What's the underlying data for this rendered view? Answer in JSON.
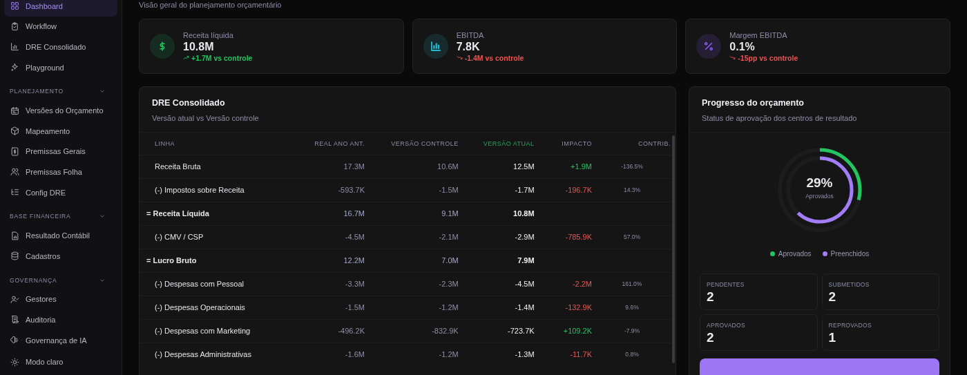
{
  "sidebar": {
    "items": [
      {
        "label": "Dashboard",
        "selected": true
      },
      {
        "label": "Workflow",
        "selected": false
      },
      {
        "label": "DRE Consolidado",
        "selected": false
      },
      {
        "label": "Playground",
        "selected": false
      }
    ],
    "sections": [
      {
        "title": "PLANEJAMENTO",
        "expanded": true,
        "items": [
          {
            "label": "Versões do Orçamento",
            "selected": false
          },
          {
            "label": "Mapeamento",
            "selected": false
          },
          {
            "label": "Premissas Gerais",
            "selected": false
          },
          {
            "label": "Premissas Folha",
            "selected": false
          },
          {
            "label": "Config DRE",
            "selected": false
          }
        ]
      },
      {
        "title": "BASE FINANCEIRA",
        "expanded": true,
        "items": [
          {
            "label": "Resultado Contábil",
            "selected": false
          },
          {
            "label": "Cadastros",
            "selected": false
          }
        ]
      },
      {
        "title": "GOVERNANÇA",
        "expanded": true,
        "items": [
          {
            "label": "Gestores",
            "selected": false
          },
          {
            "label": "Auditoria",
            "selected": false
          },
          {
            "label": "Governança de IA",
            "selected": false
          }
        ]
      }
    ],
    "theme_toggle": "Modo claro"
  },
  "page": {
    "subtitle": "Visão geral do planejamento orçamentário"
  },
  "kpis": [
    {
      "label": "Receita líquida",
      "value": "10.8M",
      "delta": {
        "text": "+1.7M vs controle",
        "color": "#22c55e"
      },
      "color": "#22c55e"
    },
    {
      "label": "EBITDA",
      "value": "7.8K",
      "delta": {
        "text": "-1.4M vs controle",
        "color": "#ef5350"
      },
      "color": "#22b8cf"
    },
    {
      "label": "Margem EBITDA",
      "value": "0.1%",
      "delta": {
        "text": "-15pp vs controle",
        "color": "#ef5350"
      },
      "color": "#8b5cf6"
    }
  ],
  "dre": {
    "title": "DRE Consolidado",
    "subtitle": "Versão atual vs Versão controle",
    "columns": [
      "LINHA",
      "REAL ANO ANT.",
      "VERSÃO CONTROLE",
      "VERSÃO ATUAL",
      "IMPACTO",
      "CONTRIB."
    ],
    "rows": [
      {
        "kind": "item",
        "cells": [
          "Receita Bruta",
          "17.3M",
          "10.6M",
          "12.5M",
          "+1.9M",
          "-136.5%"
        ],
        "color": "#22c55e"
      },
      {
        "kind": "item",
        "cells": [
          "(-) Impostos sobre Receita",
          "-593.7K",
          "-1.5M",
          "-1.7M",
          "-196.7K",
          "14.3%"
        ],
        "color": "#ef5350"
      },
      {
        "kind": "total",
        "cells": [
          "= Receita Líquida",
          "16.7M",
          "9.1M",
          "10.8M"
        ]
      },
      {
        "kind": "item",
        "cells": [
          "(-) CMV / CSP",
          "-4.5M",
          "-2.1M",
          "-2.9M",
          "-785.9K",
          "57.0%"
        ],
        "color": "#ef5350"
      },
      {
        "kind": "total",
        "cells": [
          "= Lucro Bruto",
          "12.2M",
          "7.0M",
          "7.9M"
        ]
      },
      {
        "kind": "item",
        "cells": [
          "(-) Despesas com Pessoal",
          "-3.3M",
          "-2.3M",
          "-4.5M",
          "-2.2M",
          "161.0%"
        ],
        "color": "#ef5350"
      },
      {
        "kind": "item",
        "cells": [
          "(-) Despesas Operacionais",
          "-1.5M",
          "-1.2M",
          "-1.4M",
          "-132.9K",
          "9.6%"
        ],
        "color": "#ef5350"
      },
      {
        "kind": "item",
        "cells": [
          "(-) Despesas com Marketing",
          "-496.2K",
          "-832.9K",
          "-723.7K",
          "+109.2K",
          "-7.9%"
        ],
        "color": "#22c55e"
      },
      {
        "kind": "item",
        "cells": [
          "(-) Despesas Administrativas",
          "-1.6M",
          "-1.2M",
          "-1.3M",
          "-11.7K",
          "0.8%"
        ],
        "color": "#ef5350"
      }
    ]
  },
  "progress": {
    "title": "Progresso do orçamento",
    "subtitle": "Status de aprovação dos centros de resultado",
    "percent": "29%",
    "percent_label": "Aprovados",
    "rings": [
      {
        "label": "Aprovados",
        "color": "#22c55e",
        "level": 0.29
      },
      {
        "label": "Preenchidos",
        "color": "#a37cf7",
        "level": 0.62
      }
    ],
    "stats": [
      {
        "label": "PENDENTES",
        "value": "2"
      },
      {
        "label": "SUBMETIDOS",
        "value": "2"
      },
      {
        "label": "APROVADOS",
        "value": "2"
      },
      {
        "label": "REPROVADOS",
        "value": "1"
      }
    ]
  }
}
